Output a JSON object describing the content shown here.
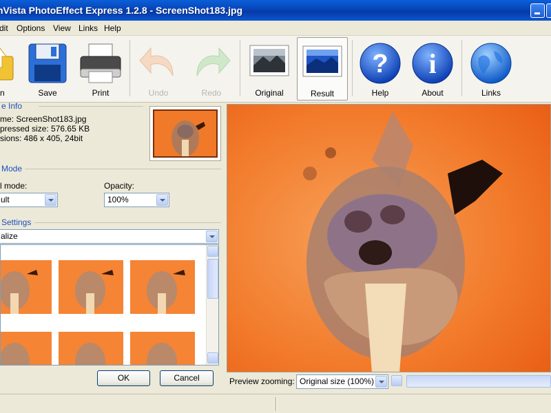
{
  "window": {
    "title": "nVista PhotoEffect Express 1.2.8 - ScreenShot183.jpg"
  },
  "menu": [
    "dit",
    "Options",
    "View",
    "Links",
    "Help"
  ],
  "toolbar": {
    "open": "n",
    "save": "Save",
    "print": "Print",
    "undo": "Undo",
    "redo": "Redo",
    "original": "Original",
    "result": "Result",
    "help": "Help",
    "about": "About",
    "links": "Links"
  },
  "file_info": {
    "title": "e Info",
    "name": "me: ScreenShot183.jpg",
    "size": "pressed size: 576.65 KB",
    "dims": "sions: 486 x 405, 24bit"
  },
  "mode": {
    "title": "Mode",
    "blend_label": "l mode:",
    "blend_value": "ult",
    "opacity_label": "Opacity:",
    "opacity_value": "100%"
  },
  "settings": {
    "title": "Settings",
    "effect_value": "alize"
  },
  "buttons": {
    "ok": "OK",
    "cancel": "Cancel"
  },
  "zoom": {
    "label": "Preview zooming:",
    "value": "Original size (100%)"
  },
  "colors": {
    "accent": "#1b4fbf",
    "titlebar": "#0a56d0",
    "orange": "#f07a2a"
  }
}
